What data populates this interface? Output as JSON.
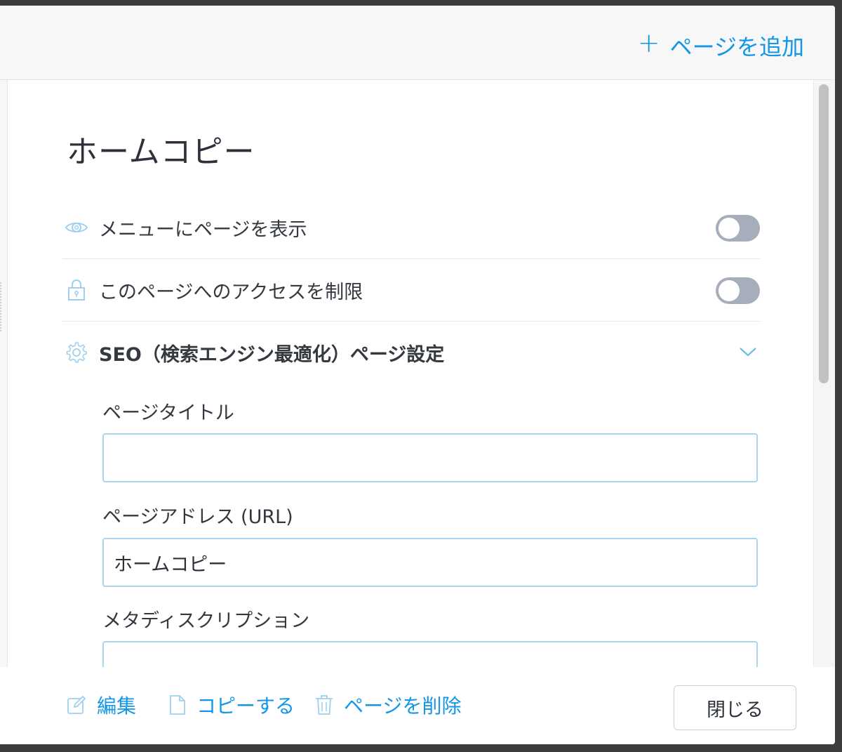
{
  "header": {
    "add_page_label": "ページを追加",
    "add_icon": "plus-icon"
  },
  "page": {
    "title": "ホームコピー"
  },
  "settings": {
    "show_in_menu": {
      "label": "メニューにページを表示",
      "icon": "eye-icon",
      "enabled": false
    },
    "restrict_access": {
      "label": "このページへのアクセスを制限",
      "icon": "lock-icon",
      "enabled": false
    },
    "seo": {
      "label": "SEO（検索エンジン最適化）ページ設定",
      "icon": "gear-icon",
      "expanded": true,
      "fields": {
        "page_title": {
          "label": "ページタイトル",
          "value": ""
        },
        "page_address": {
          "label": "ページアドレス (URL)",
          "value": "ホームコピー"
        },
        "meta_description": {
          "label": "メタディスクリプション",
          "value": ""
        }
      }
    }
  },
  "footer": {
    "edit_label": "編集",
    "copy_label": "コピーする",
    "delete_label": "ページを削除",
    "close_label": "閉じる"
  },
  "colors": {
    "accent": "#1496e6",
    "toggle_off": "#a6aebb",
    "field_border": "#a9d3ef",
    "text": "#2d323a"
  }
}
